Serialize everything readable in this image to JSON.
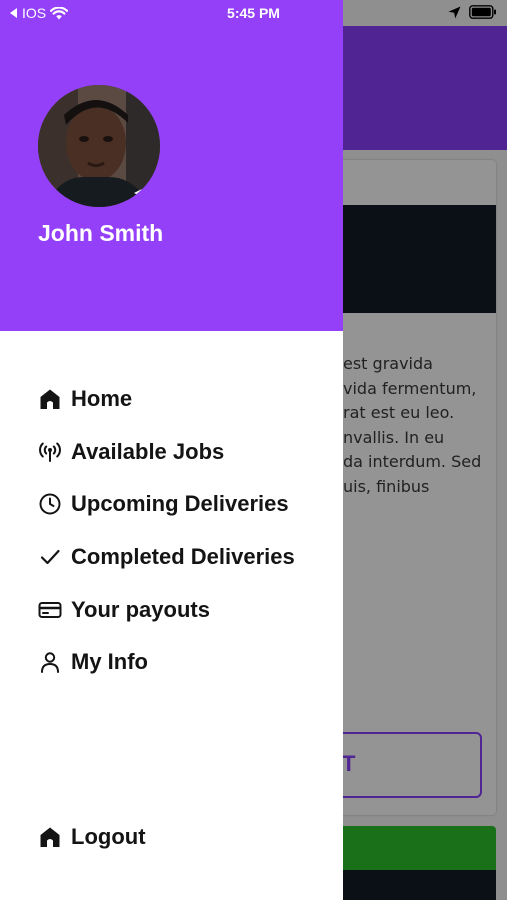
{
  "status_bar": {
    "back_label": "IOS",
    "time": "5:45 PM"
  },
  "colors": {
    "drawer_header": "#9440f9",
    "accent": "#8a3ffc",
    "success": "#2bc12b"
  },
  "drawer": {
    "user_name": "John Smith",
    "menu": [
      {
        "label": "Home",
        "icon": "home-icon"
      },
      {
        "label": "Available Jobs",
        "icon": "broadcast-icon"
      },
      {
        "label": "Upcoming Deliveries",
        "icon": "clock-icon"
      },
      {
        "label": "Completed Deliveries",
        "icon": "checkmark-icon"
      },
      {
        "label": "Your payouts",
        "icon": "credit-card-icon"
      },
      {
        "label": "My Info",
        "icon": "person-icon"
      }
    ],
    "logout": {
      "label": "Logout",
      "icon": "home-icon"
    }
  },
  "background": {
    "body_text": "est gravida\nvida fermentum,\nrat est eu leo.\nnvallis. In eu\nda interdum. Sed\nuis, finibus",
    "outline_button_label": "T"
  }
}
